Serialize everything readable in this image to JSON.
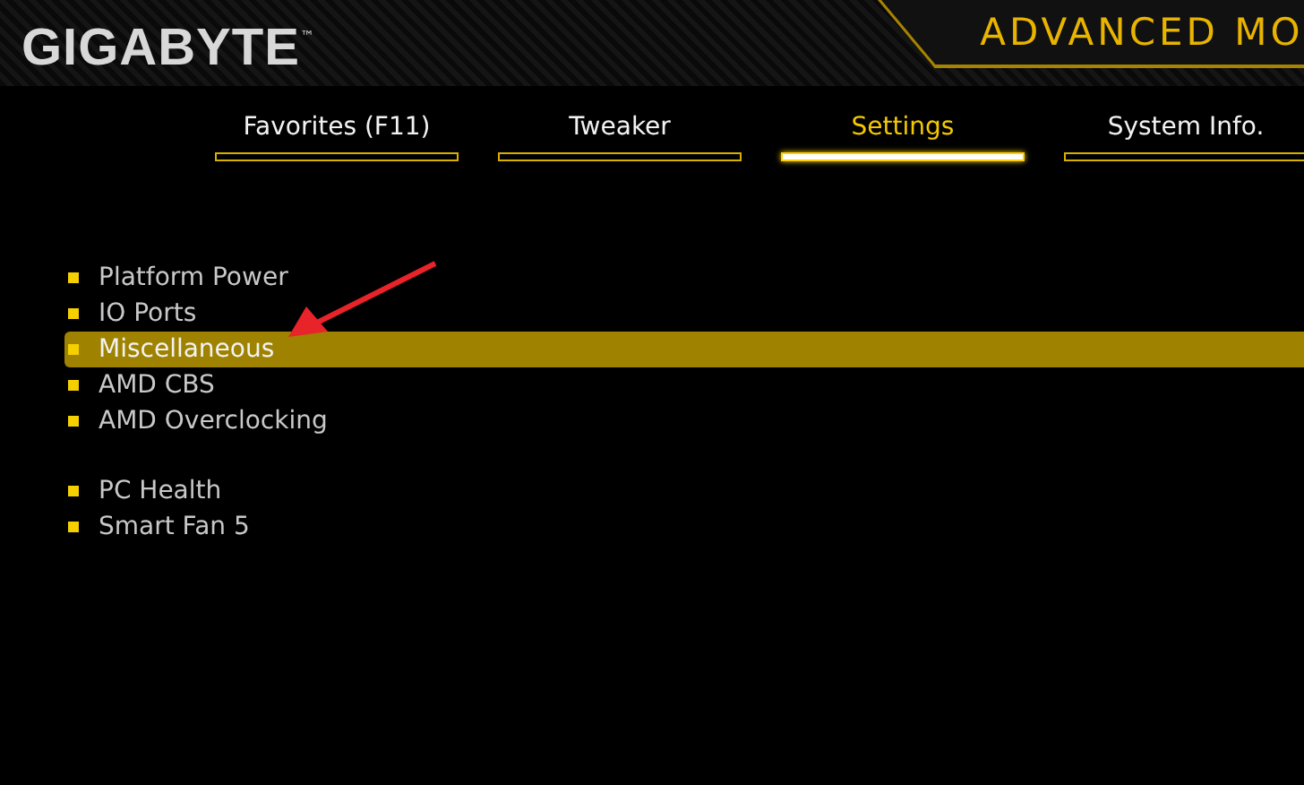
{
  "header": {
    "logo": "GIGABYTE",
    "trademark": "™",
    "mode_title": "ADVANCED MO"
  },
  "tabs": [
    {
      "label": "Favorites (F11)",
      "selected": false
    },
    {
      "label": "Tweaker",
      "selected": false
    },
    {
      "label": "Settings",
      "selected": true
    },
    {
      "label": "System Info.",
      "selected": false
    }
  ],
  "menu_groups": [
    {
      "items": [
        {
          "label": "Platform Power",
          "selected": false
        },
        {
          "label": "IO Ports",
          "selected": false
        },
        {
          "label": "Miscellaneous",
          "selected": true
        },
        {
          "label": "AMD CBS",
          "selected": false
        },
        {
          "label": "AMD Overclocking",
          "selected": false
        }
      ]
    },
    {
      "items": [
        {
          "label": "PC Health",
          "selected": false
        },
        {
          "label": "Smart Fan 5",
          "selected": false
        }
      ]
    }
  ],
  "annotation": {
    "kind": "arrow"
  }
}
